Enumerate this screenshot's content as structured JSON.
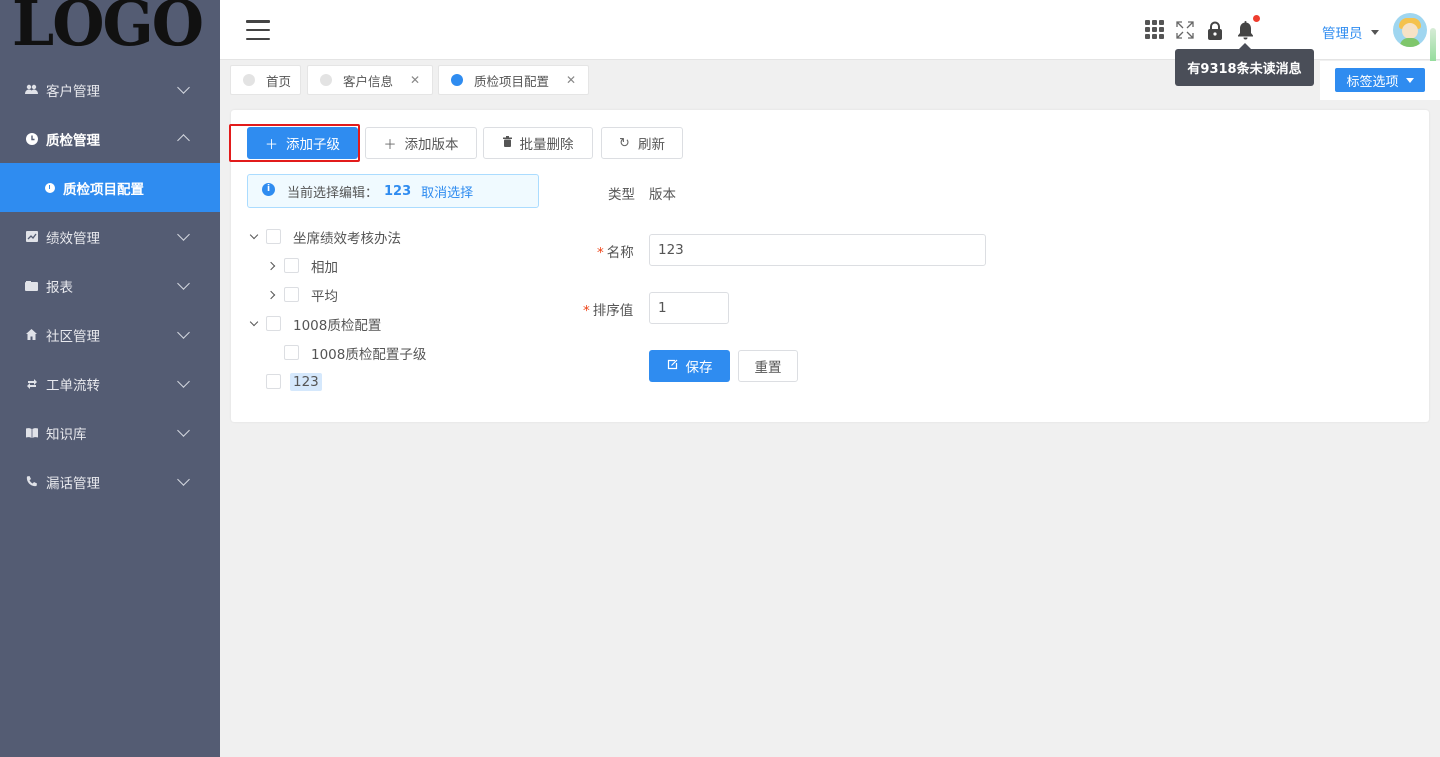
{
  "logo": {
    "text": "LOGO"
  },
  "sidebar": {
    "items": [
      {
        "label": "客户管理",
        "icon": "users-icon"
      },
      {
        "label": "质检管理",
        "icon": "clock-icon",
        "open": true,
        "children": [
          {
            "label": "质检项目配置",
            "active": true
          }
        ]
      },
      {
        "label": "绩效管理",
        "icon": "chart-icon"
      },
      {
        "label": "报表",
        "icon": "folder-icon"
      },
      {
        "label": "社区管理",
        "icon": "home-icon"
      },
      {
        "label": "工单流转",
        "icon": "refresh-icon"
      },
      {
        "label": "知识库",
        "icon": "book-icon"
      },
      {
        "label": "漏话管理",
        "icon": "phone-icon"
      }
    ]
  },
  "header": {
    "user_name": "管理员",
    "notification_tooltip": "有9318条未读消息"
  },
  "tabs": [
    {
      "label": "首页",
      "closable": false,
      "active": false
    },
    {
      "label": "客户信息",
      "closable": true,
      "active": false
    },
    {
      "label": "质检项目配置",
      "closable": true,
      "active": true
    }
  ],
  "tag_options_label": "标签选项",
  "toolbar": {
    "add_child": "添加子级",
    "add_version": "添加版本",
    "batch_delete": "批量删除",
    "refresh": "刷新"
  },
  "selection_alert": {
    "prefix": "当前选择编辑：",
    "selected": "123",
    "cancel": "取消选择"
  },
  "tree": {
    "nodes": [
      {
        "label": "坐席绩效考核办法",
        "level": 0,
        "expand": "down"
      },
      {
        "label": "相加",
        "level": 1,
        "expand": "right"
      },
      {
        "label": "平均",
        "level": 1,
        "expand": "right"
      },
      {
        "label": "1008质检配置",
        "level": 0,
        "expand": "down"
      },
      {
        "label": "1008质检配置子级",
        "level": 1,
        "expand": "none"
      },
      {
        "label": "123",
        "level": 0,
        "expand": "none",
        "selected": true
      }
    ]
  },
  "form": {
    "type_label": "类型",
    "type_value": "版本",
    "name_label": "名称",
    "name_value": "123",
    "sort_label": "排序值",
    "sort_value": "1",
    "save": "保存",
    "reset": "重置"
  },
  "colors": {
    "primary": "#2f8cf0",
    "sidebar_bg": "#545c73",
    "highlight": "#e21b1b"
  }
}
